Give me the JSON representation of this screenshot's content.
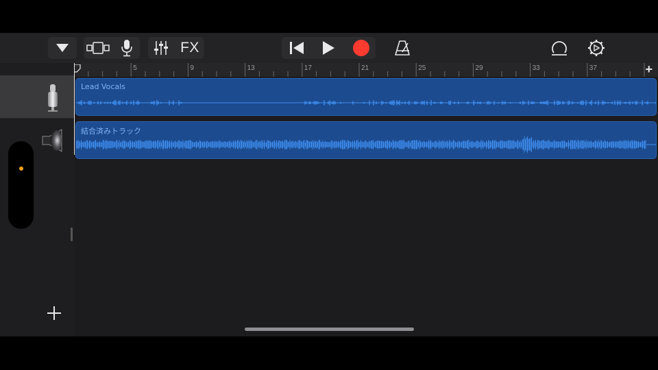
{
  "toolbar": {
    "buttons": [
      {
        "name": "browser-toggle",
        "icon": "triangle-down-icon"
      },
      {
        "name": "views",
        "icon": "tracks-view-icon"
      },
      {
        "name": "smart-controls",
        "icon": "microphone-icon"
      },
      {
        "name": "mixer",
        "icon": "sliders-icon"
      },
      {
        "name": "fx",
        "label": "FX"
      },
      {
        "name": "go-to-beginning",
        "icon": "skip-back-icon"
      },
      {
        "name": "play",
        "icon": "play-icon"
      },
      {
        "name": "record",
        "icon": "record-icon"
      },
      {
        "name": "metronome",
        "icon": "metronome-icon"
      },
      {
        "name": "loop-browser",
        "icon": "loop-icon"
      },
      {
        "name": "settings",
        "icon": "gear-icon"
      }
    ],
    "fx_label": "FX"
  },
  "colors": {
    "record": "#ff3b30",
    "region_fill": "#1c4b8f",
    "region_wave": "#3f8ff2",
    "mixer_dot": "#f7a21b"
  },
  "ruler": {
    "bars": [
      "5",
      "9",
      "13",
      "17",
      "21",
      "25",
      "29",
      "33",
      "37"
    ],
    "add_label": "+"
  },
  "tracks": [
    {
      "instrument_icon": "condenser-microphone-icon",
      "selected": true,
      "region_label": "Lead Vocals"
    },
    {
      "instrument_icon": "speaker-icon",
      "selected": false,
      "region_label": "結合済みトラック"
    }
  ],
  "add_track_icon": "plus-icon"
}
